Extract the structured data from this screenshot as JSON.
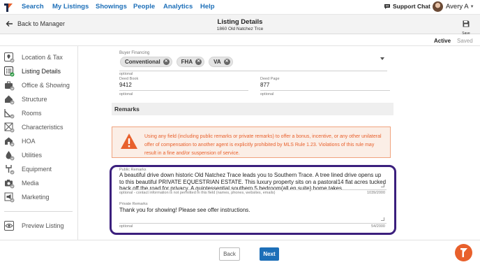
{
  "nav": {
    "links": [
      "Search",
      "My Listings",
      "Showings",
      "People",
      "Analytics",
      "Help"
    ],
    "support_label": "Support Chat",
    "user_name": "Avery A"
  },
  "header": {
    "back_label": "Back to Manager",
    "title": "Listing Details",
    "subtitle": "1860 Old Natchez Trce",
    "save_label": "Save"
  },
  "status": {
    "active": "Active",
    "saved": "Saved"
  },
  "sidebar": {
    "items": [
      {
        "label": "Location & Tax",
        "icon": "location-icon"
      },
      {
        "label": "Listing Details",
        "icon": "list-icon"
      },
      {
        "label": "Office & Showing",
        "icon": "briefcase-icon"
      },
      {
        "label": "Structure",
        "icon": "house-icon"
      },
      {
        "label": "Rooms",
        "icon": "floorplan-icon"
      },
      {
        "label": "Characteristics",
        "icon": "characteristics-icon"
      },
      {
        "label": "HOA",
        "icon": "hoa-icon"
      },
      {
        "label": "Utilities",
        "icon": "utilities-icon"
      },
      {
        "label": "Equipment",
        "icon": "equipment-icon"
      },
      {
        "label": "Media",
        "icon": "camera-icon"
      },
      {
        "label": "Marketing",
        "icon": "megaphone-icon"
      }
    ],
    "preview_label": "Preview Listing"
  },
  "form": {
    "buyer_financing_label": "Buyer Financing",
    "financing_chips": [
      "Conventional",
      "FHA",
      "VA"
    ],
    "financing_hint": "optional",
    "deed_book_label": "Deed Book",
    "deed_book_value": "9412",
    "deed_book_hint": "optional",
    "deed_page_label": "Deed Page",
    "deed_page_value": "877",
    "deed_page_hint": "optional",
    "remarks_section": "Remarks",
    "warning": "Using any field (including public remarks or private remarks) to offer a bonus, incentive, or any other unilateral offer of compensation to another agent is explicitly prohibited by MLS Rule 1.23. Violations of this rule may result in a fine and/or suspension of service.",
    "public_remarks_label": "Public Remarks",
    "public_remarks_value": "A beautiful drive down historic Old Natchez Trace leads you to Southern Trace. A tree lined drive opens up to this beautiful PRIVATE EQUESTRIAN ESTATE. This luxury property sits on a pastoral14 flat acres tucked back off the road for privacy. A quintessential southern 5 bedroom(all en suite) home takes",
    "public_remarks_hint": "optional - contact information is not permitted in this field (names, phones, websites, emails)",
    "public_remarks_count": "1039/2000",
    "private_remarks_label": "Private Remarks",
    "private_remarks_value": "Thank you for showing!  Please see offer instructions.",
    "private_remarks_hint": "optional",
    "private_remarks_count": "54/2000"
  },
  "footer": {
    "back_label": "Back",
    "next_label": "Next"
  },
  "colors": {
    "brand": "#1d6fb8",
    "accent": "#e8602c",
    "highlight": "#3b1f7d",
    "check": "#2e9a44"
  }
}
